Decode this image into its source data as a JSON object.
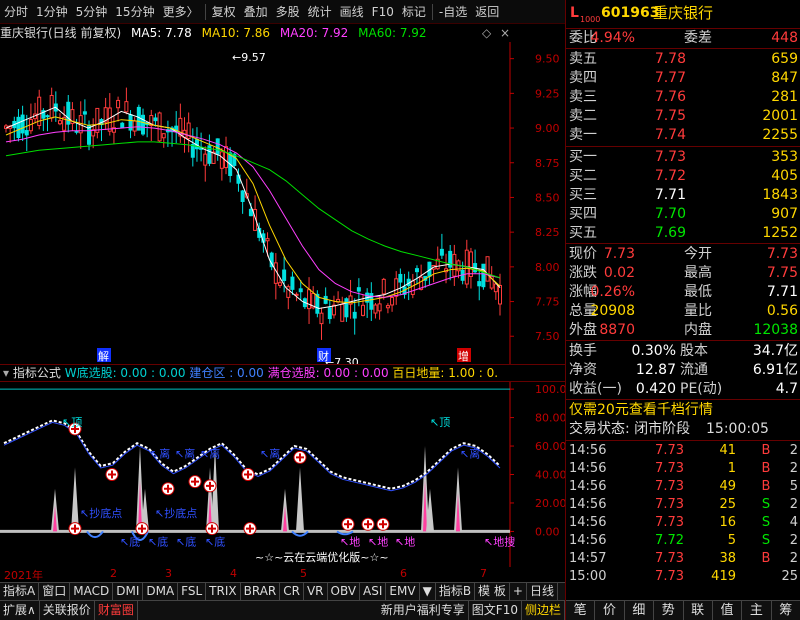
{
  "toolbar": {
    "items": [
      "分时",
      "1分钟",
      "5分钟",
      "15分钟",
      "更多〉",
      "复权",
      "叠加",
      "多股",
      "统计",
      "画线",
      "F10",
      "标记",
      "-自选",
      "返回"
    ]
  },
  "price_header": {
    "title": "重庆银行(日线 前复权)",
    "ma5": "MA5: 7.78",
    "ma10": "MA10: 7.86",
    "ma20": "MA20: 7.92",
    "ma60": "MA60: 7.92",
    "btn_a": "◇",
    "btn_b": "×"
  },
  "colors": {
    "up": "#ff3b3b",
    "down": "#00e0e0",
    "ma5": "#ffffff",
    "ma10": "#ffd700",
    "ma20": "#ff40ff",
    "ma60": "#00e000",
    "axis": "#c00000"
  },
  "chart_data": [
    {
      "type": "candlestick",
      "title": "重庆银行(日线 前复权)",
      "y_ticks": [
        "9.50",
        "9.25",
        "9.00",
        "8.75",
        "8.50",
        "8.25",
        "8.00",
        "7.75",
        "7.50"
      ],
      "ylim": [
        7.3,
        9.62
      ],
      "annotations": [
        "9.57",
        "7.30",
        "解",
        "财",
        "增"
      ],
      "series": [
        {
          "name": "MA5",
          "values": [
            9.0,
            9.05,
            9.1,
            9.15,
            9.05,
            9.0,
            9.05,
            9.12,
            9.08,
            9.02,
            9.0,
            8.92,
            8.85,
            8.8,
            8.7,
            8.4,
            8.05,
            7.85,
            7.75,
            7.7,
            7.72,
            7.75,
            7.78,
            7.8,
            7.85,
            7.92,
            8.0,
            8.02,
            8.0,
            7.98,
            7.85
          ]
        },
        {
          "name": "MA10",
          "values": [
            8.95,
            9.0,
            9.05,
            9.08,
            9.05,
            9.02,
            9.03,
            9.06,
            9.05,
            9.02,
            9.0,
            8.95,
            8.9,
            8.85,
            8.78,
            8.6,
            8.3,
            8.05,
            7.88,
            7.78,
            7.75,
            7.74,
            7.76,
            7.78,
            7.82,
            7.88,
            7.95,
            7.98,
            7.99,
            7.97,
            7.86
          ]
        },
        {
          "name": "MA20",
          "values": [
            8.9,
            8.92,
            8.95,
            8.97,
            8.98,
            8.98,
            8.99,
            9.0,
            9.01,
            9.0,
            8.98,
            8.95,
            8.92,
            8.88,
            8.82,
            8.72,
            8.55,
            8.35,
            8.15,
            7.98,
            7.88,
            7.82,
            7.79,
            7.78,
            7.8,
            7.84,
            7.88,
            7.92,
            7.95,
            7.95,
            7.92
          ]
        },
        {
          "name": "MA60",
          "values": [
            8.8,
            8.82,
            8.84,
            8.85,
            8.86,
            8.87,
            8.88,
            8.89,
            8.9,
            8.9,
            8.89,
            8.88,
            8.86,
            8.84,
            8.8,
            8.75,
            8.7,
            8.62,
            8.52,
            8.42,
            8.34,
            8.26,
            8.2,
            8.15,
            8.11,
            8.08,
            8.05,
            8.02,
            8.0,
            7.96,
            7.92
          ]
        }
      ]
    },
    {
      "type": "line",
      "title": "指标公式",
      "y_ticks": [
        "100.0",
        "80.00",
        "60.00",
        "40.00",
        "20.00",
        "0.00"
      ],
      "ylim": [
        -25,
        105
      ],
      "series": [
        {
          "values": [
            62,
            66,
            70,
            74,
            78,
            76,
            70,
            56,
            46,
            48,
            56,
            62,
            58,
            48,
            42,
            46,
            52,
            58,
            62,
            54,
            44,
            40,
            44,
            52,
            60,
            58,
            50,
            42,
            38,
            36,
            34,
            32,
            30,
            32,
            36,
            42,
            50,
            58,
            62,
            60,
            54,
            46
          ]
        }
      ],
      "labels": [
        "顶",
        "抄底点",
        "抄底点",
        "底",
        "底",
        "底",
        "底",
        "地",
        "地",
        "地",
        "地搜",
        "顶",
        "离",
        "离",
        "离",
        "离",
        "离"
      ],
      "plus_markers": 17
    }
  ],
  "indicator_header": {
    "name": "指标公式",
    "w_buy": "W底选股: 0.00 : 0.00",
    "bottom_zone": "建仓区 : 0.00",
    "full_buy": "满仓选股: 0.00 : 0.00",
    "day100": "百日地量: 1.00 : 0."
  },
  "watermark": "~☆~云在云端优化版~☆~",
  "date_axis": [
    "2021年",
    "2",
    "3",
    "4",
    "5",
    "6",
    "7"
  ],
  "tabs1": [
    "指标A",
    "窗口",
    "MACD",
    "DMI",
    "DMA",
    "FSL",
    "TRIX",
    "BRAR",
    "CR",
    "VR",
    "OBV",
    "ASI",
    "EMV",
    "▼",
    "指标B",
    "模 板",
    "+",
    "日线"
  ],
  "tabs2": [
    "扩展∧",
    "关联报价",
    "财富圈"
  ],
  "tabs2_right": [
    "新用户福利专享",
    "图文F10",
    "侧边栏"
  ],
  "quote": {
    "code": "601963",
    "name": "重庆银行",
    "prefix": "L",
    "sub": "1000",
    "weibi_label": "委比",
    "weibi": "4.94%",
    "weicha_label": "委差",
    "weicha": "448",
    "asks": [
      {
        "label": "卖五",
        "price": "7.78",
        "vol": "659"
      },
      {
        "label": "卖四",
        "price": "7.77",
        "vol": "847"
      },
      {
        "label": "卖三",
        "price": "7.76",
        "vol": "281"
      },
      {
        "label": "卖二",
        "price": "7.75",
        "vol": "2001"
      },
      {
        "label": "卖一",
        "price": "7.74",
        "vol": "2255"
      }
    ],
    "bids": [
      {
        "label": "买一",
        "price": "7.73",
        "vol": "353"
      },
      {
        "label": "买二",
        "price": "7.72",
        "vol": "405"
      },
      {
        "label": "买三",
        "price": "7.71",
        "vol": "1843"
      },
      {
        "label": "买四",
        "price": "7.70",
        "vol": "907"
      },
      {
        "label": "买五",
        "price": "7.69",
        "vol": "1252"
      }
    ],
    "stats": [
      {
        "l1": "现价",
        "v1": "7.73",
        "l2": "今开",
        "v2": "7.73"
      },
      {
        "l1": "涨跌",
        "v1": "0.02",
        "l2": "最高",
        "v2": "7.75"
      },
      {
        "l1": "涨幅",
        "v1": "0.26%",
        "l2": "最低",
        "v2": "7.71"
      },
      {
        "l1": "总量",
        "v1": "20908",
        "l2": "量比",
        "v2": "0.56"
      },
      {
        "l1": "外盘",
        "v1": "8870",
        "l2": "内盘",
        "v2": "12038"
      }
    ],
    "stats2": [
      {
        "l1": "换手",
        "v1": "0.30%",
        "l2": "股本",
        "v2": "34.7亿"
      },
      {
        "l1": "净资",
        "v1": "12.87",
        "l2": "流通",
        "v2": "6.91亿"
      },
      {
        "l1": "收益(一)",
        "v1": "0.420",
        "l2": "PE(动)",
        "v2": "4.7"
      }
    ],
    "promo": "仅需20元查看千档行情",
    "status_label": "交易状态: 闭市阶段",
    "status_time": "15:00:05",
    "ticks": [
      {
        "t": "14:56",
        "p": "7.73",
        "v": "41",
        "bs": "B",
        "n": "2"
      },
      {
        "t": "14:56",
        "p": "7.73",
        "v": "1",
        "bs": "B",
        "n": "2"
      },
      {
        "t": "14:56",
        "p": "7.73",
        "v": "49",
        "bs": "B",
        "n": "5"
      },
      {
        "t": "14:56",
        "p": "7.73",
        "v": "25",
        "bs": "S",
        "n": "2"
      },
      {
        "t": "14:56",
        "p": "7.73",
        "v": "16",
        "bs": "S",
        "n": "4"
      },
      {
        "t": "14:56",
        "p": "7.72",
        "v": "5",
        "bs": "S",
        "n": "2"
      },
      {
        "t": "14:57",
        "p": "7.73",
        "v": "38",
        "bs": "B",
        "n": "2"
      },
      {
        "t": "15:00",
        "p": "7.73",
        "v": "419",
        "bs": "",
        "n": "25"
      }
    ],
    "bottom_tabs": [
      "笔",
      "价",
      "细",
      "势",
      "联",
      "值",
      "主",
      "筹"
    ]
  }
}
